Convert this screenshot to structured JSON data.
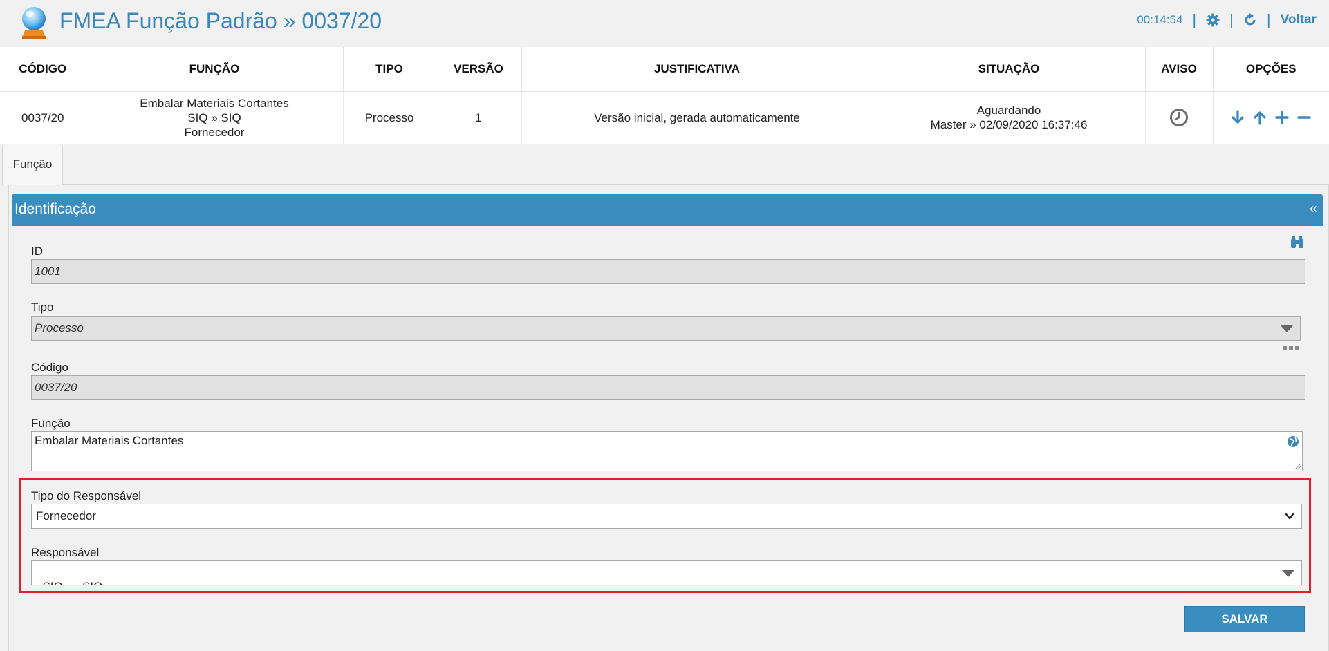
{
  "header": {
    "title": "FMEA Função Padrão » 0037/20",
    "timer": "00:14:54",
    "back_label": "Voltar",
    "accent": "#3a87b9"
  },
  "summary_table": {
    "columns": [
      "CÓDIGO",
      "FUNÇÃO",
      "TIPO",
      "VERSÃO",
      "JUSTIFICATIVA",
      "SITUAÇÃO",
      "AVISO",
      "OPÇÕES"
    ],
    "row": {
      "codigo": "0037/20",
      "funcao_line1": "Embalar Materiais Cortantes",
      "funcao_line2": "SIQ » SIQ",
      "funcao_line3": "Fornecedor",
      "tipo": "Processo",
      "versao": "1",
      "justificativa": "Versão inicial, gerada automaticamente",
      "situacao_line1": "Aguardando",
      "situacao_line2": "Master » 02/09/2020 16:37:46",
      "aviso_icon": "clock-icon"
    },
    "options_icons": [
      "arrow-down-icon",
      "arrow-up-icon",
      "plus-icon",
      "minus-icon"
    ]
  },
  "tabs": [
    {
      "label": "Função"
    }
  ],
  "panel": {
    "title": "Identificação",
    "collapse_label": "«",
    "header_color": "#3a8dbf"
  },
  "form": {
    "id_label": "ID",
    "id_value": "1001",
    "tipo_label": "Tipo",
    "tipo_value": "Processo",
    "codigo_label": "Código",
    "codigo_value": "0037/20",
    "funcao_label": "Função",
    "funcao_value": "Embalar Materiais Cortantes",
    "tipo_responsavel_label": "Tipo do Responsável",
    "tipo_responsavel_value": "Fornecedor",
    "responsavel_label": "Responsável",
    "responsavel_value": "SIQ  »  SIQ",
    "save_label": "SALVAR",
    "highlight_color": "#d7242b"
  }
}
